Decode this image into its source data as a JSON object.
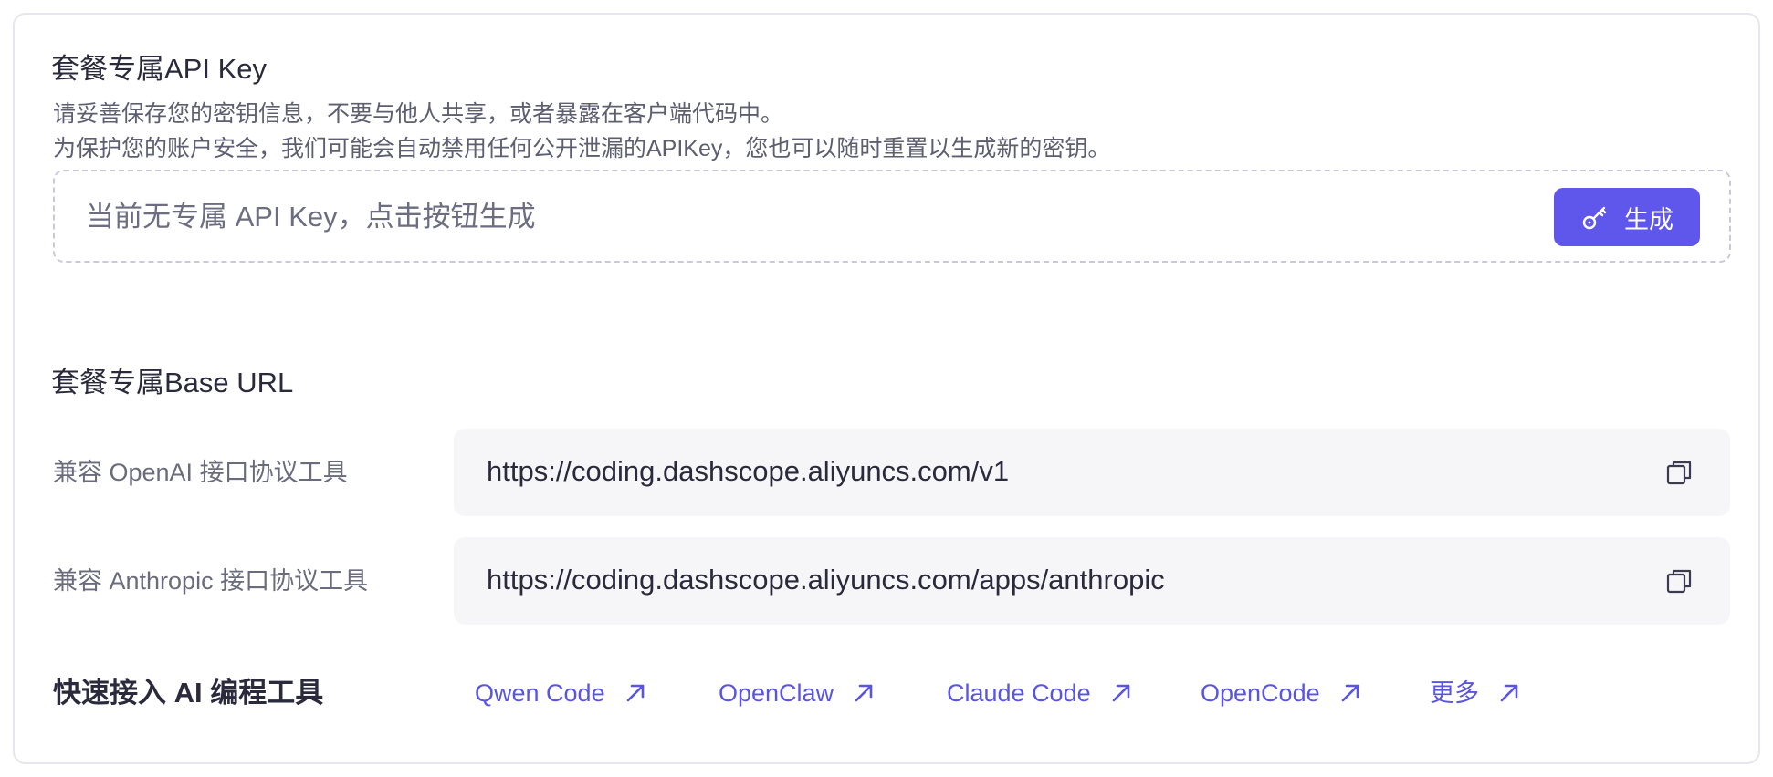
{
  "api_key_section": {
    "title": "套餐专属API Key",
    "desc_line1": "请妥善保存您的密钥信息，不要与他人共享，或者暴露在客户端代码中。",
    "desc_line2": "为保护您的账户安全，我们可能会自动禁用任何公开泄漏的APIKey，您也可以随时重置以生成新的密钥。",
    "placeholder": "当前无专属 API Key，点击按钮生成",
    "generate_button": "生成",
    "generate_icon": "key-icon"
  },
  "base_url_section": {
    "title": "套餐专属Base URL",
    "rows": [
      {
        "label": "兼容 OpenAI 接口协议工具",
        "url": "https://coding.dashscope.aliyuncs.com/v1",
        "copy_icon": "copy-icon"
      },
      {
        "label": "兼容 Anthropic 接口协议工具",
        "url": "https://coding.dashscope.aliyuncs.com/apps/anthropic",
        "copy_icon": "copy-icon"
      }
    ]
  },
  "tools_section": {
    "title": "快速接入 AI 编程工具",
    "links": [
      {
        "label": "Qwen Code",
        "icon": "external-arrow-icon"
      },
      {
        "label": "OpenClaw",
        "icon": "external-arrow-icon"
      },
      {
        "label": "Claude Code",
        "icon": "external-arrow-icon"
      },
      {
        "label": "OpenCode",
        "icon": "external-arrow-icon"
      },
      {
        "label": "更多",
        "icon": "external-arrow-icon"
      }
    ]
  },
  "colors": {
    "accent": "#5f57ec",
    "link": "#5a55e0",
    "field_bg": "#f6f6f9",
    "border": "#e6e6ec"
  }
}
